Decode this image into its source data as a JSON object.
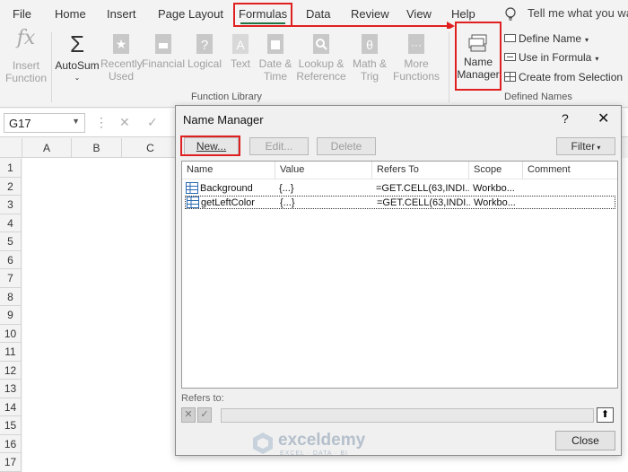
{
  "menu": {
    "items": [
      "File",
      "Home",
      "Insert",
      "Page Layout",
      "Formulas",
      "Data",
      "Review",
      "View",
      "Help"
    ],
    "tell_me": "Tell me what you want"
  },
  "ribbon": {
    "insert_function": "Insert\nFunction",
    "autosum": "AutoSum",
    "recently_used": "Recently\nUsed",
    "financial": "Financial",
    "logical": "Logical",
    "text": "Text",
    "date_time": "Date &\nTime",
    "lookup_reference": "Lookup &\nReference",
    "math_trig": "Math &\nTrig",
    "more_functions": "More\nFunctions",
    "function_library_label": "Function Library",
    "name_manager": "Name\nManager",
    "define_name": "Define Name",
    "use_in_formula": "Use in Formula",
    "create_from_selection": "Create from Selection",
    "defined_names_label": "Defined Names"
  },
  "formula_bar": {
    "name_box": "G17"
  },
  "sheet": {
    "columns": [
      "A",
      "B",
      "C"
    ],
    "rows": [
      "1",
      "2",
      "3",
      "4",
      "5",
      "6",
      "7",
      "8",
      "9",
      "10",
      "11",
      "12",
      "13",
      "14",
      "15",
      "16",
      "17"
    ]
  },
  "dialog": {
    "title": "Name Manager",
    "help": "?",
    "close_glyph": "✕",
    "buttons": {
      "new": "New...",
      "edit": "Edit...",
      "delete": "Delete",
      "filter": "Filter"
    },
    "columns": [
      "Name",
      "Value",
      "Refers To",
      "Scope",
      "Comment"
    ],
    "rows": [
      {
        "name": "Background",
        "value": "{...}",
        "refers_to": "=GET.CELL(63,INDI...",
        "scope": "Workbo...",
        "comment": ""
      },
      {
        "name": "getLeftColor",
        "value": "{...}",
        "refers_to": "=GET.CELL(63,INDI...",
        "scope": "Workbo...",
        "comment": ""
      }
    ],
    "refers_to_label": "Refers to:",
    "close_button": "Close"
  },
  "watermark": {
    "name": "exceldemy",
    "tagline": "EXCEL · DATA · BI"
  },
  "colors": {
    "highlight": "#e02020",
    "excel_green": "#217346"
  }
}
